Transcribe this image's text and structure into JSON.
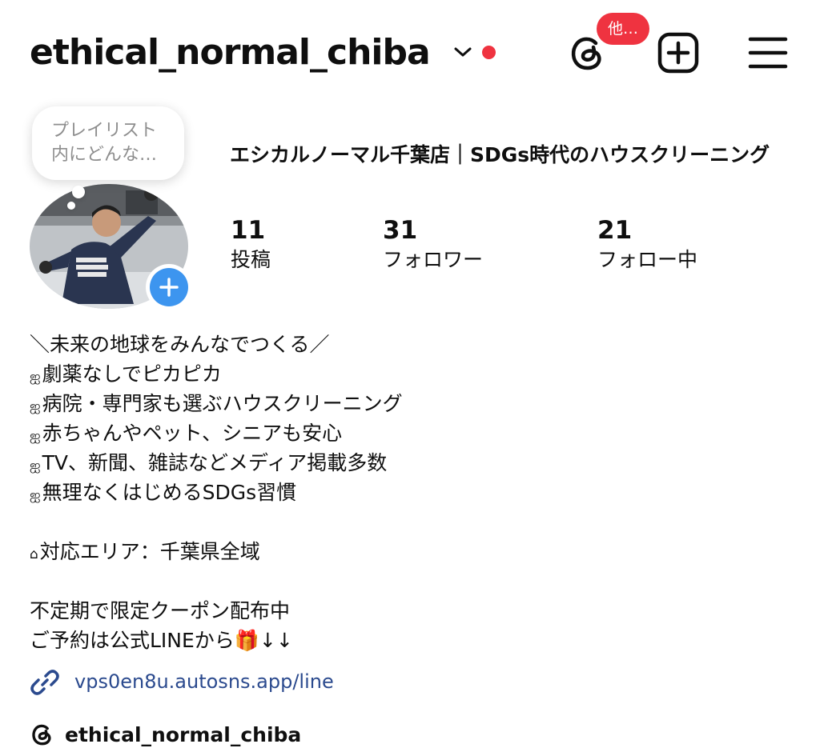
{
  "header": {
    "username": "ethical_normal_chiba",
    "threads_badge": "他…",
    "icons": [
      "chevron-down-icon",
      "threads-icon",
      "add-content-icon",
      "menu-icon"
    ],
    "status_dot_color": "#ef3340"
  },
  "profile": {
    "note_lines": [
      "プレイリスト",
      "内にどんな…"
    ],
    "display_name": "エシカルノーマル千葉店｜SDGs時代のハウスクリーニング",
    "stats": [
      {
        "count": "11",
        "label": "投稿"
      },
      {
        "count": "31",
        "label": "フォロワー"
      },
      {
        "count": "21",
        "label": "フォロー中"
      }
    ],
    "story_add_color": "#3d95ef"
  },
  "bio": {
    "headline": "＼未来の地球をみんなでつくる／",
    "bullet": "ஐ",
    "points": [
      "劇薬なしでピカピカ",
      "病院・専門家も選ぶハウスクリーニング",
      "赤ちゃんやペット、シニアも安心",
      "TV、新聞、雑誌などメディア掲載多数",
      "無理なくはじめるSDGs習慣"
    ],
    "area_icon": "⌂",
    "area": "対応エリア：千葉県全域",
    "coupon": "不定期で限定クーポン配布中",
    "reserve": "ご予約は公式LINEから🎁↓↓"
  },
  "link": {
    "url_text": "vps0en8u.autosns.app/line",
    "color": "#2b4a8e"
  },
  "threads": {
    "handle": "ethical_normal_chiba"
  }
}
